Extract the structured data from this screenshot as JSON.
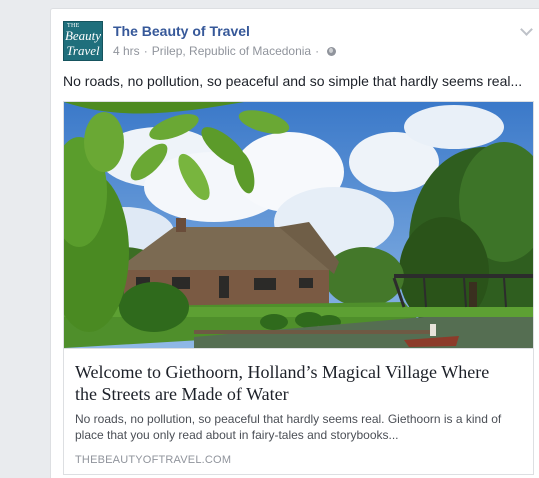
{
  "post": {
    "page_name": "The Beauty of Travel",
    "avatar_text": {
      "small": "THE",
      "line1": "Beauty",
      "line2": "Travel"
    },
    "time": "4 hrs",
    "separator": "·",
    "location": "Prilep, Republic of Macedonia",
    "privacy_icon": "globe-icon",
    "menu_icon": "chevron-down-icon",
    "text": "No roads, no pollution, so peaceful and so simple that hardly seems real..."
  },
  "link": {
    "image_desc_icon": "photo",
    "title": "Welcome to Giethoorn, Holland’s Magical Village Where the Streets are Made of Water",
    "description": "No roads, no pollution, so peaceful that hardly seems real. Giethoorn is a kind of place that you only read about in fairy-tales and storybooks...",
    "domain": "THEBEAUTYOFTRAVEL.COM"
  },
  "colors": {
    "page_bg": "#e9ebee",
    "link_blue": "#365899",
    "meta_grey": "#90949c",
    "text": "#1d2129"
  }
}
